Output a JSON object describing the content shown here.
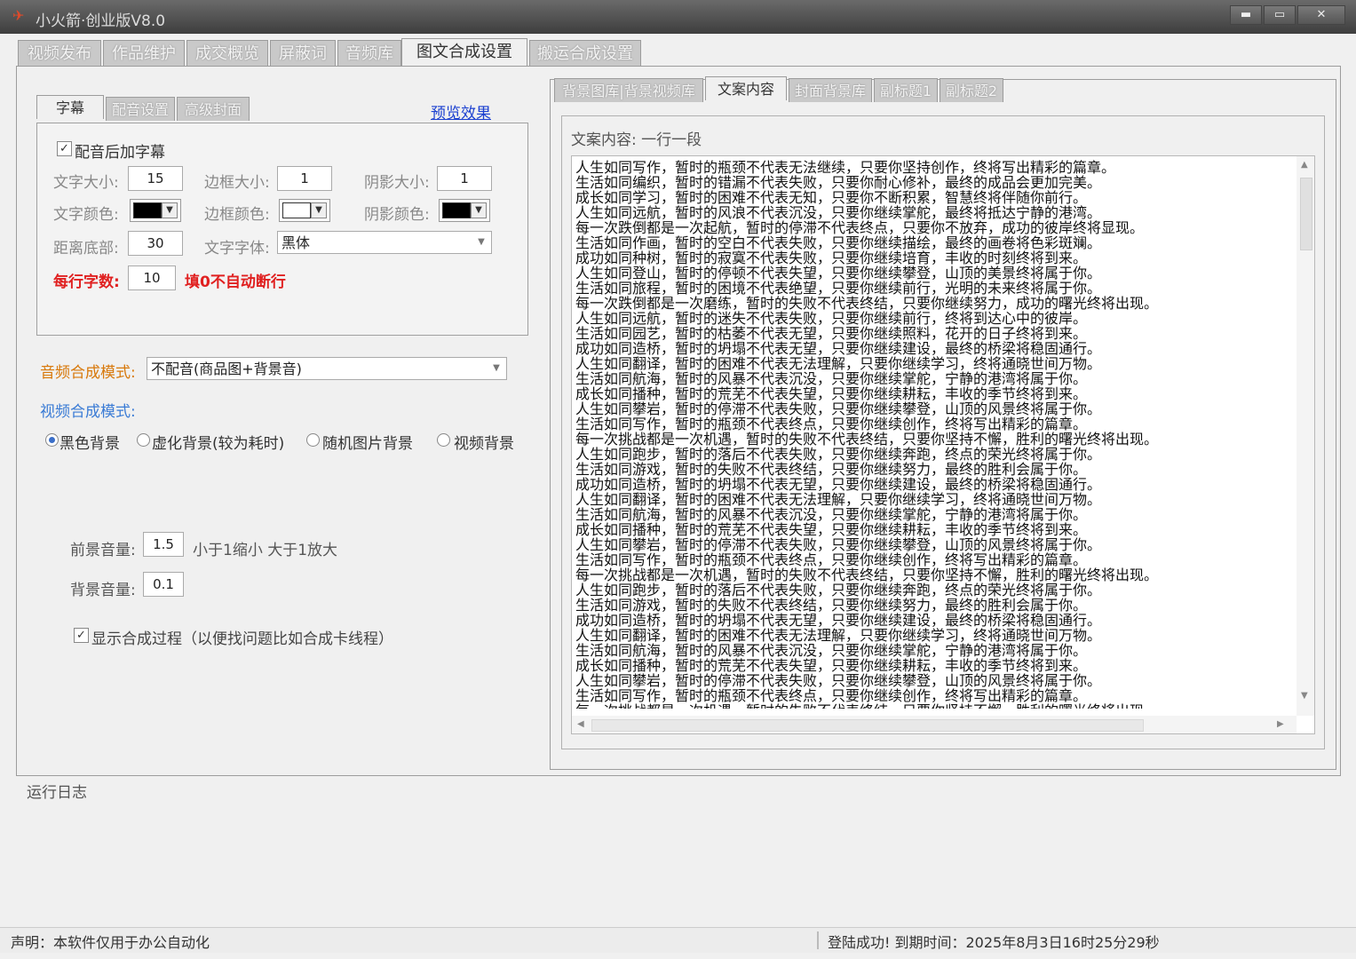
{
  "window": {
    "title": "小火箭·创业版V8.0",
    "min": "▬",
    "max": "▭",
    "close": "✕"
  },
  "main_tabs": [
    "视频发布",
    "作品维护",
    "成交概览",
    "屏蔽词",
    "音频库",
    "图文合成设置",
    "搬运合成设置"
  ],
  "left": {
    "sub_tabs": [
      "字幕",
      "配音设置",
      "高级封面"
    ],
    "preview_link": "预览效果",
    "add_subtitle_label": "配音后加字幕",
    "add_subtitle_checked": "✓",
    "font_size_label": "文字大小:",
    "font_size": "15",
    "border_size_label": "边框大小:",
    "border_size": "1",
    "shadow_size_label": "阴影大小:",
    "shadow_size": "1",
    "font_color_label": "文字颜色:",
    "font_color": "#000000",
    "border_color_label": "边框颜色:",
    "border_color": "#ffffff",
    "shadow_color_label": "阴影颜色:",
    "shadow_color": "#000000",
    "bottom_margin_label": "距离底部:",
    "bottom_margin": "30",
    "font_family_label": "文字字体:",
    "font_family": "黑体",
    "chars_per_line_label": "每行字数:",
    "chars_per_line": "10",
    "chars_per_line_hint": "填0不自动断行",
    "audio_mode_label": "音频合成模式:",
    "audio_mode": "不配音(商品图+背景音)",
    "video_mode_label": "视频合成模式:",
    "video_modes": [
      "黑色背景",
      "虚化背景(较为耗时)",
      "随机图片背景",
      "视频背景"
    ],
    "fg_volume_label": "前景音量:",
    "fg_volume": "1.5",
    "fg_volume_hint": "小于1缩小 大于1放大",
    "bg_volume_label": "背景音量:",
    "bg_volume": "0.1",
    "show_process_label": "显示合成过程（以便找问题比如合成卡线程）",
    "show_process_checked": "✓"
  },
  "right": {
    "tabs": [
      "背景图库|背景视频库",
      "文案内容",
      "封面背景库",
      "副标题1",
      "副标题2"
    ],
    "panel_label": "文案内容: 一行一段",
    "lines": [
      "人生如同写作，暂时的瓶颈不代表无法继续，只要你坚持创作，终将写出精彩的篇章。",
      "生活如同编织，暂时的错漏不代表失败，只要你耐心修补，最终的成品会更加完美。",
      "成长如同学习，暂时的困难不代表无知，只要你不断积累，智慧终将伴随你前行。",
      "人生如同远航，暂时的风浪不代表沉没，只要你继续掌舵，最终将抵达宁静的港湾。",
      "每一次跌倒都是一次起航，暂时的停滞不代表终点，只要你不放弃，成功的彼岸终将显现。",
      "生活如同作画，暂时的空白不代表失败，只要你继续描绘，最终的画卷将色彩斑斓。",
      "成功如同种树，暂时的寂寞不代表失败，只要你继续培育，丰收的时刻终将到来。",
      "人生如同登山，暂时的停顿不代表失望，只要你继续攀登，山顶的美景终将属于你。",
      "生活如同旅程，暂时的困境不代表绝望，只要你继续前行，光明的未来终将属于你。",
      "每一次跌倒都是一次磨练，暂时的失败不代表终结，只要你继续努力，成功的曙光终将出现。",
      "人生如同远航，暂时的迷失不代表失败，只要你继续前行，终将到达心中的彼岸。",
      "生活如同园艺，暂时的枯萎不代表无望，只要你继续照料，花开的日子终将到来。",
      "成功如同造桥，暂时的坍塌不代表无望，只要你继续建设，最终的桥梁将稳固通行。",
      "人生如同翻译，暂时的困难不代表无法理解，只要你继续学习，终将通晓世间万物。",
      "生活如同航海，暂时的风暴不代表沉没，只要你继续掌舵，宁静的港湾将属于你。",
      "成长如同播种，暂时的荒芜不代表失望，只要你继续耕耘，丰收的季节终将到来。",
      "人生如同攀岩，暂时的停滞不代表失败，只要你继续攀登，山顶的风景终将属于你。",
      "生活如同写作，暂时的瓶颈不代表终点，只要你继续创作，终将写出精彩的篇章。",
      "每一次挑战都是一次机遇，暂时的失败不代表终结，只要你坚持不懈，胜利的曙光终将出现。",
      "人生如同跑步，暂时的落后不代表失败，只要你继续奔跑，终点的荣光终将属于你。",
      "生活如同游戏，暂时的失败不代表终结，只要你继续努力，最终的胜利会属于你。",
      "成功如同造桥，暂时的坍塌不代表无望，只要你继续建设，最终的桥梁将稳固通行。",
      "人生如同翻译，暂时的困难不代表无法理解，只要你继续学习，终将通晓世间万物。",
      "生活如同航海，暂时的风暴不代表沉没，只要你继续掌舵，宁静的港湾将属于你。",
      "成长如同播种，暂时的荒芜不代表失望，只要你继续耕耘，丰收的季节终将到来。",
      "人生如同攀岩，暂时的停滞不代表失败，只要你继续攀登，山顶的风景终将属于你。",
      "生活如同写作，暂时的瓶颈不代表终点，只要你继续创作，终将写出精彩的篇章。",
      "每一次挑战都是一次机遇，暂时的失败不代表终结，只要你坚持不懈，胜利的曙光终将出现。",
      "人生如同跑步，暂时的落后不代表失败，只要你继续奔跑，终点的荣光终将属于你。",
      "生活如同游戏，暂时的失败不代表终结，只要你继续努力，最终的胜利会属于你。",
      "成功如同造桥，暂时的坍塌不代表无望，只要你继续建设，最终的桥梁将稳固通行。",
      "人生如同翻译，暂时的困难不代表无法理解，只要你继续学习，终将通晓世间万物。",
      "生活如同航海，暂时的风暴不代表沉没，只要你继续掌舵，宁静的港湾将属于你。",
      "成长如同播种，暂时的荒芜不代表失望，只要你继续耕耘，丰收的季节终将到来。",
      "人生如同攀岩，暂时的停滞不代表失败，只要你继续攀登，山顶的风景终将属于你。",
      "生活如同写作，暂时的瓶颈不代表终点，只要你继续创作，终将写出精彩的篇章。",
      "每一次挑战都是一次机遇，暂时的失败不代表终结，只要你坚持不懈，胜利的曙光终将出现。"
    ]
  },
  "log": {
    "label": "运行日志"
  },
  "status": {
    "disclaimer": "声明：本软件仅用于办公自动化",
    "login": "登陆成功! 到期时间：2025年8月3日16时25分29秒"
  }
}
